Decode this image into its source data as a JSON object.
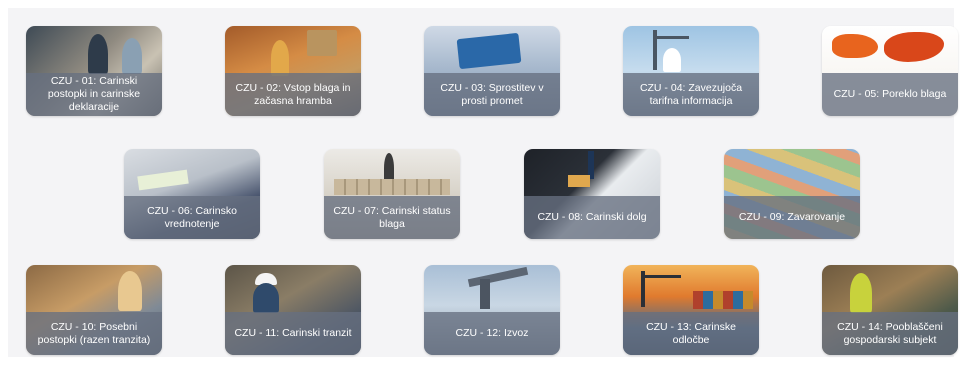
{
  "tiles": [
    {
      "label": "CZU - 01: Carinski postopki in carinske deklaracije",
      "image": "office-workers-photo"
    },
    {
      "label": "CZU - 02: Vstop blaga in začasna hramba",
      "image": "warehouse-worker-photo"
    },
    {
      "label": "CZU - 03: Sprostitev v prosti promet",
      "image": "world-map-tablet-photo"
    },
    {
      "label": "CZU - 04: Zavezujoča tarifna informacija",
      "image": "port-cranes-photo"
    },
    {
      "label": "CZU - 05: Poreklo blaga",
      "image": "orange-world-map-photo"
    },
    {
      "label": "CZU - 06: Carinsko vrednotenje",
      "image": "paperwork-desk-photo"
    },
    {
      "label": "CZU - 07: Carinski status blaga",
      "image": "figure-on-boxes-photo"
    },
    {
      "label": "CZU - 08: Carinski dolg",
      "image": "businessman-money-photo"
    },
    {
      "label": "CZU - 09: Zavarovanje",
      "image": "banknotes-photo"
    },
    {
      "label": "CZU - 10: Posebni postopki (razen tranzita)",
      "image": "warehouse-woman-photo"
    },
    {
      "label": "CZU - 11: Carinski tranzit",
      "image": "worker-hardhat-photo"
    },
    {
      "label": "CZU - 12: Izvoz",
      "image": "cargo-plane-photo"
    },
    {
      "label": "CZU - 13: Carinske odločbe",
      "image": "container-port-sunset-photo"
    },
    {
      "label": "CZU - 14: Pooblaščeni gospodarski subjekt",
      "image": "warehouse-worker-woman-photo"
    }
  ]
}
